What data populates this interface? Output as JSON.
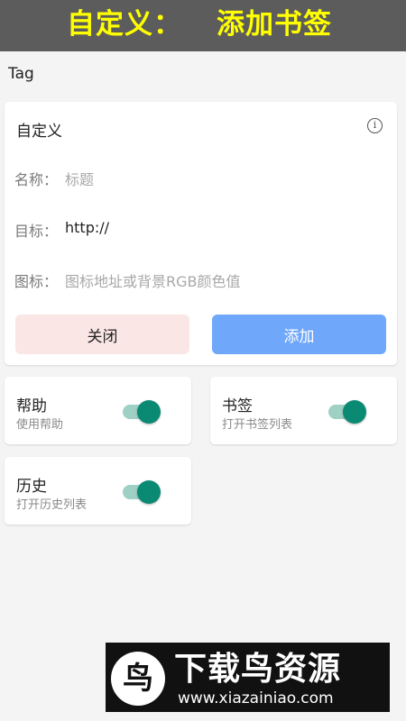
{
  "banner": {
    "title_left": "自定义：",
    "title_right": "添加书签"
  },
  "tag_label": "Tag",
  "form": {
    "title": "自定义",
    "info_icon": "info-icon",
    "name_label": "名称：",
    "name_placeholder": "标题",
    "target_label": "目标：",
    "target_value": "http://",
    "icon_label": "图标：",
    "icon_placeholder": "图标地址或背景RGB颜色值",
    "close_label": "关闭",
    "add_label": "添加"
  },
  "toggles": [
    {
      "title": "帮助",
      "subtitle": "使用帮助",
      "on": true
    },
    {
      "title": "书签",
      "subtitle": "打开书签列表",
      "on": true
    },
    {
      "title": "历史",
      "subtitle": "打开历史列表",
      "on": true
    }
  ],
  "colors": {
    "banner_bg": "#5c5c5c",
    "banner_text": "#ffff00",
    "toggle_on": "#0b8a73",
    "add_button": "#6fa8fb",
    "close_button": "#fae6e4"
  },
  "watermark": {
    "logo_text": "下载鸟资源",
    "url": "www.xiazainiao.com"
  }
}
